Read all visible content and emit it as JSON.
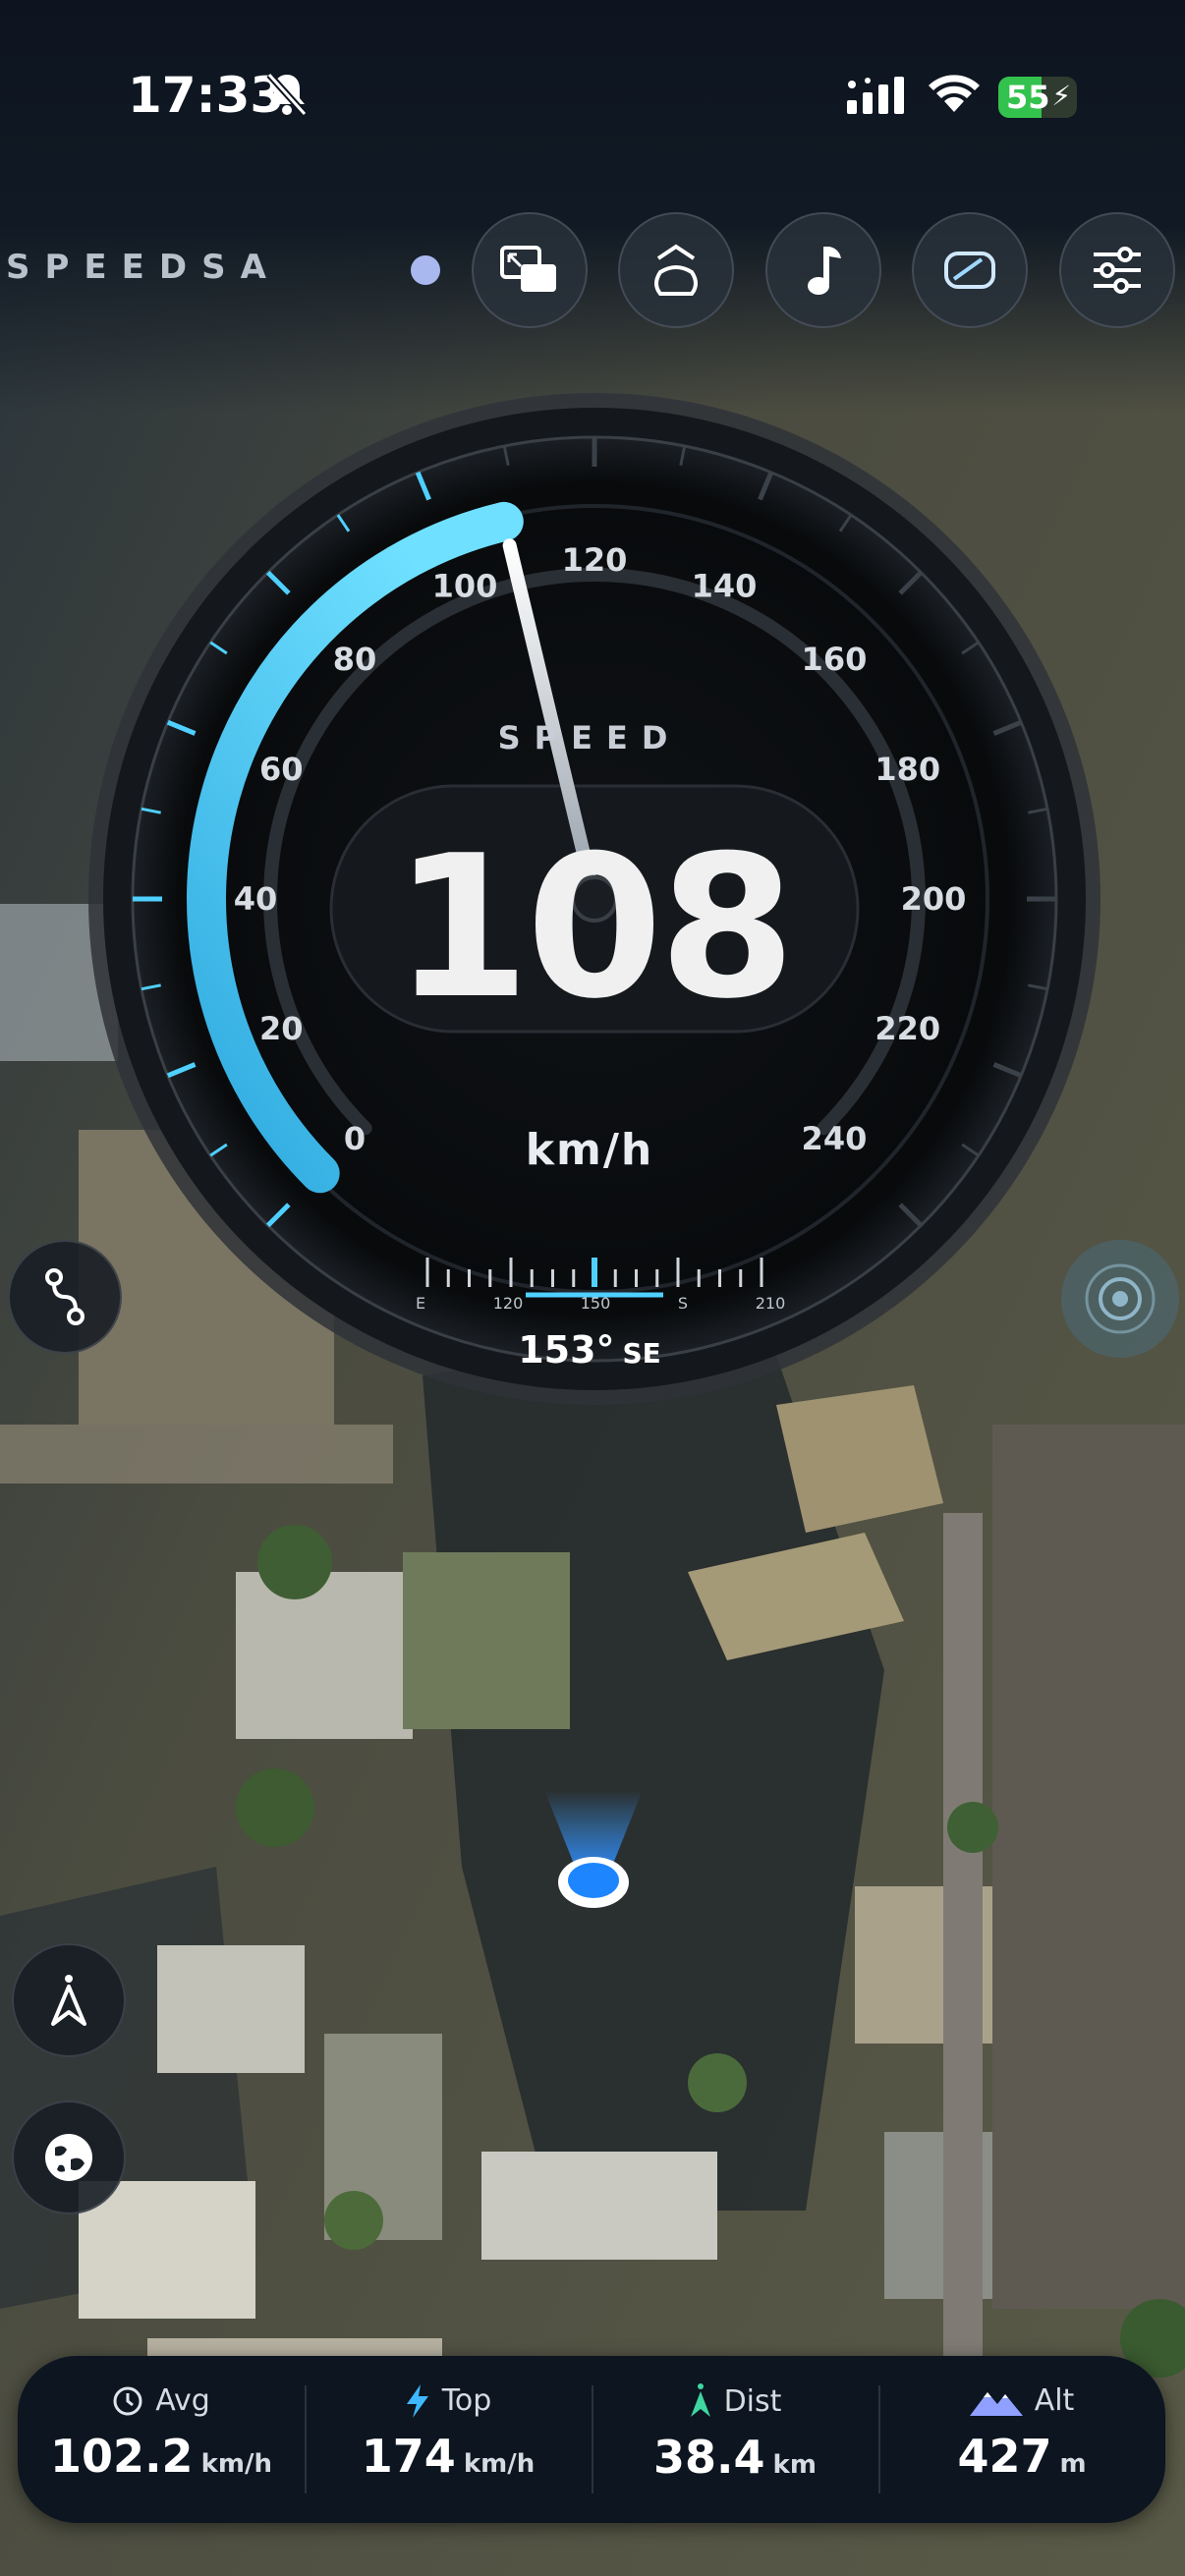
{
  "status_bar": {
    "time": "17:33",
    "battery": "55"
  },
  "header": {
    "brand": "SPEEDSA"
  },
  "icons": {
    "header_buttons": [
      "pip-icon",
      "hud-icon",
      "music-note-icon",
      "mirror-icon",
      "sliders-icon"
    ],
    "left_buttons": [
      "route-icon",
      "compass-arrow-icon",
      "globe-icon"
    ],
    "right_button": "recenter-icon"
  },
  "gauge": {
    "label": "SPEED",
    "value": "108",
    "unit": "km/h",
    "min": 0,
    "max": 240,
    "current": 108,
    "ticks": [
      "0",
      "20",
      "40",
      "60",
      "80",
      "100",
      "120",
      "140",
      "160",
      "180",
      "200",
      "220",
      "240"
    ],
    "compass": {
      "heading": "153°",
      "cardinal": "SE",
      "scale": [
        "E",
        "120",
        "150",
        "S",
        "210"
      ]
    },
    "accent": "#4fd0ff"
  },
  "stats": [
    {
      "icon": "clock-icon",
      "label": "Avg",
      "value": "102.2",
      "unit": "km/h"
    },
    {
      "icon": "bolt-icon",
      "label": "Top",
      "value": "174",
      "unit": "km/h"
    },
    {
      "icon": "north-arrow-icon",
      "label": "Dist",
      "value": "38.4",
      "unit": "km"
    },
    {
      "icon": "mountain-icon",
      "label": "Alt",
      "value": "427",
      "unit": "m"
    }
  ]
}
